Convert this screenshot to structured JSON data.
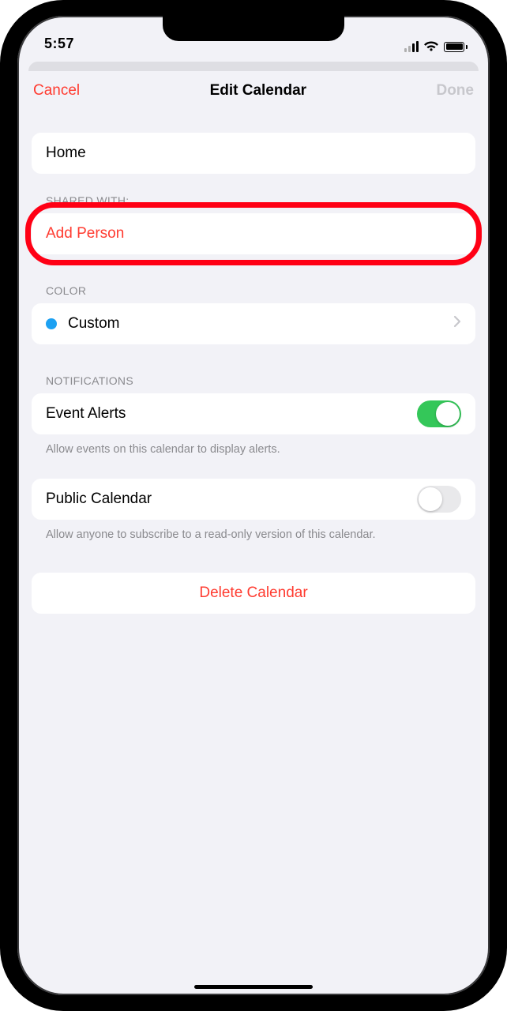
{
  "status": {
    "time": "5:57"
  },
  "nav": {
    "cancel": "Cancel",
    "title": "Edit Calendar",
    "done": "Done"
  },
  "calendar": {
    "name": "Home"
  },
  "shared": {
    "header": "SHARED WITH:",
    "add_person": "Add Person"
  },
  "color": {
    "header": "COLOR",
    "label": "Custom",
    "hex": "#1da1f2"
  },
  "notifications": {
    "header": "NOTIFICATIONS",
    "event_alerts_label": "Event Alerts",
    "event_alerts_on": true,
    "event_alerts_hint": "Allow events on this calendar to display alerts.",
    "public_label": "Public Calendar",
    "public_on": false,
    "public_hint": "Allow anyone to subscribe to a read-only version of this calendar."
  },
  "delete": {
    "label": "Delete Calendar"
  }
}
